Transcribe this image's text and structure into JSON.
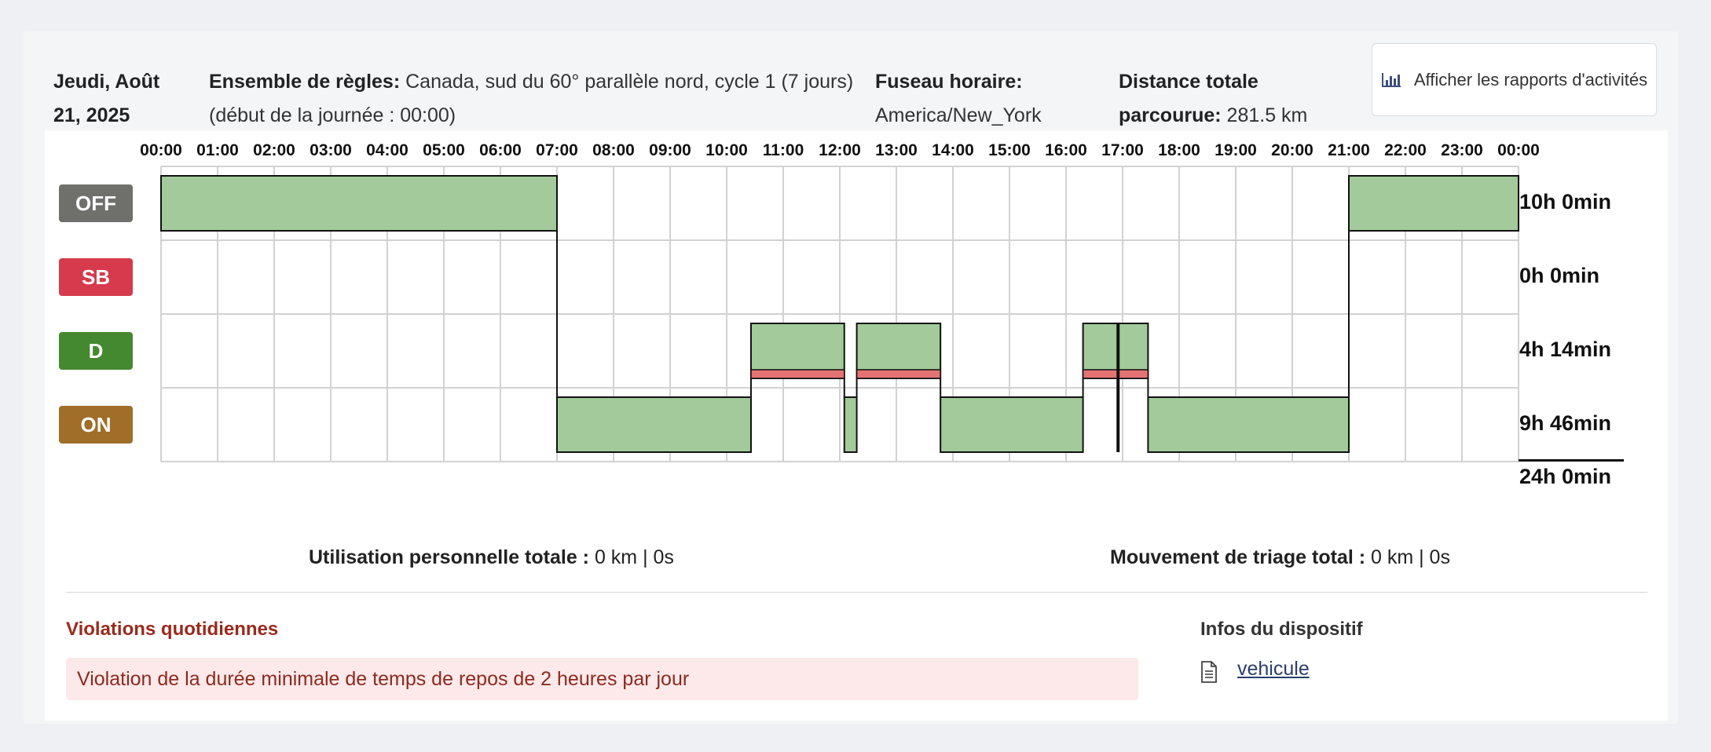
{
  "header": {
    "date_line1": "Jeudi, Août",
    "date_line2": "21, 2025",
    "ruleset_label": "Ensemble de règles:",
    "ruleset_value": "Canada, sud du 60° parallèle nord, cycle 1 (7 jours)",
    "ruleset_value2": "(début de la journée : 00:00)",
    "timezone_label": "Fuseau horaire:",
    "timezone_value": "America/New_York",
    "distance_label1": "Distance totale",
    "distance_label2": "parcourue:",
    "distance_value": "281.5 km",
    "report_button": "Afficher les rapports d'activités",
    "report_icon": "bar-chart-icon"
  },
  "chart_data": {
    "type": "timeline",
    "hours": [
      "00:00",
      "01:00",
      "02:00",
      "03:00",
      "04:00",
      "05:00",
      "06:00",
      "07:00",
      "08:00",
      "09:00",
      "10:00",
      "11:00",
      "12:00",
      "13:00",
      "14:00",
      "15:00",
      "16:00",
      "17:00",
      "18:00",
      "19:00",
      "20:00",
      "21:00",
      "22:00",
      "23:00",
      "00:00"
    ],
    "statuses": [
      {
        "code": "OFF",
        "color": "#6f706c",
        "total": "10h 0min"
      },
      {
        "code": "SB",
        "color": "#d63a4c",
        "total": "0h 0min"
      },
      {
        "code": "D",
        "color": "#44892f",
        "total": "4h 14min"
      },
      {
        "code": "ON",
        "color": "#a06e28",
        "total": "9h 46min"
      }
    ],
    "grand_total": "24h 0min",
    "segments": [
      {
        "status": "OFF",
        "start": 0,
        "end": 7
      },
      {
        "status": "ON",
        "start": 7,
        "end": 10.43
      },
      {
        "status": "D",
        "start": 10.43,
        "end": 12.08
      },
      {
        "status": "ON",
        "start": 12.08,
        "end": 12.3
      },
      {
        "status": "D",
        "start": 12.3,
        "end": 13.78
      },
      {
        "status": "ON",
        "start": 13.78,
        "end": 16.3
      },
      {
        "status": "D",
        "start": 16.3,
        "end": 17.45
      },
      {
        "status": "ON",
        "start": 17.45,
        "end": 21
      },
      {
        "status": "OFF",
        "start": 21,
        "end": 24
      }
    ],
    "violations": [
      {
        "start": 10.43,
        "end": 12.08
      },
      {
        "start": 12.3,
        "end": 13.78
      },
      {
        "start": 16.3,
        "end": 17.45
      }
    ],
    "marker": 16.92,
    "fill_color": "#a2ca9a",
    "violation_color": "#e57373"
  },
  "metrics": {
    "personal_label": "Utilisation personnelle totale :",
    "personal_value": "0 km | 0s",
    "yard_label": "Mouvement de triage total :",
    "yard_value": "0 km | 0s"
  },
  "violations": {
    "title": "Violations quotidiennes",
    "title_color": "#9a2a1c",
    "items": [
      "Violation de la durée minimale de temps de repos de 2 heures par jour"
    ]
  },
  "device": {
    "title": "Infos du dispositif",
    "link": "vehicule",
    "icon": "document-icon"
  }
}
